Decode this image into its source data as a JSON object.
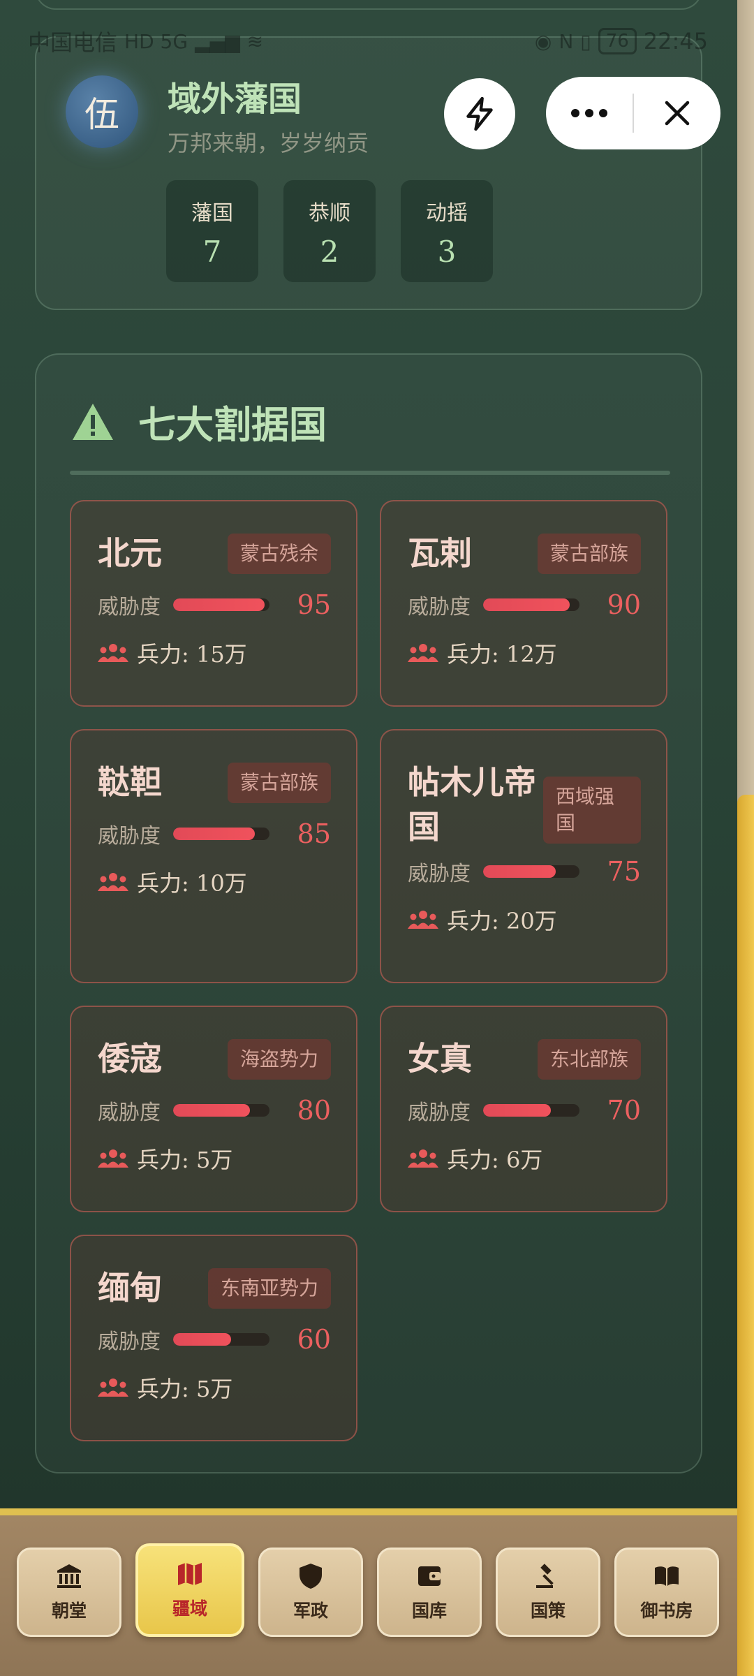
{
  "status_bar": {
    "carrier": "中国电信",
    "network": "HD 5G",
    "battery": "76",
    "time": "22:45"
  },
  "header": {
    "avatar_char": "伍",
    "title": "域外藩国",
    "subtitle": "万邦来朝，岁岁纳贡",
    "stats": [
      {
        "label": "藩国",
        "value": "7"
      },
      {
        "label": "恭顺",
        "value": "2"
      },
      {
        "label": "动摇",
        "value": "3"
      }
    ]
  },
  "section": {
    "title": "七大割据国",
    "threat_label": "威胁度",
    "countries": [
      {
        "name": "北元",
        "tag": "蒙古残余",
        "threat": 95,
        "troops": "兵力: 15万"
      },
      {
        "name": "瓦剌",
        "tag": "蒙古部族",
        "threat": 90,
        "troops": "兵力: 12万"
      },
      {
        "name": "鞑靼",
        "tag": "蒙古部族",
        "threat": 85,
        "troops": "兵力: 10万"
      },
      {
        "name": "帖木儿帝国",
        "tag": "西域强国",
        "threat": 75,
        "troops": "兵力: 20万"
      },
      {
        "name": "倭寇",
        "tag": "海盗势力",
        "threat": 80,
        "troops": "兵力: 5万"
      },
      {
        "name": "女真",
        "tag": "东北部族",
        "threat": 70,
        "troops": "兵力: 6万"
      },
      {
        "name": "缅甸",
        "tag": "东南亚势力",
        "threat": 60,
        "troops": "兵力: 5万"
      }
    ]
  },
  "nav": {
    "active": "疆域",
    "items": [
      {
        "label": "朝堂",
        "icon": "court-icon"
      },
      {
        "label": "疆域",
        "icon": "map-icon"
      },
      {
        "label": "军政",
        "icon": "shield-icon"
      },
      {
        "label": "国库",
        "icon": "wallet-icon"
      },
      {
        "label": "国策",
        "icon": "gavel-icon"
      },
      {
        "label": "御书房",
        "icon": "book-icon"
      }
    ]
  },
  "colors": {
    "accent_green": "#bfe3b8",
    "threat_red": "#ec6060",
    "nav_active": "#f0d060"
  }
}
